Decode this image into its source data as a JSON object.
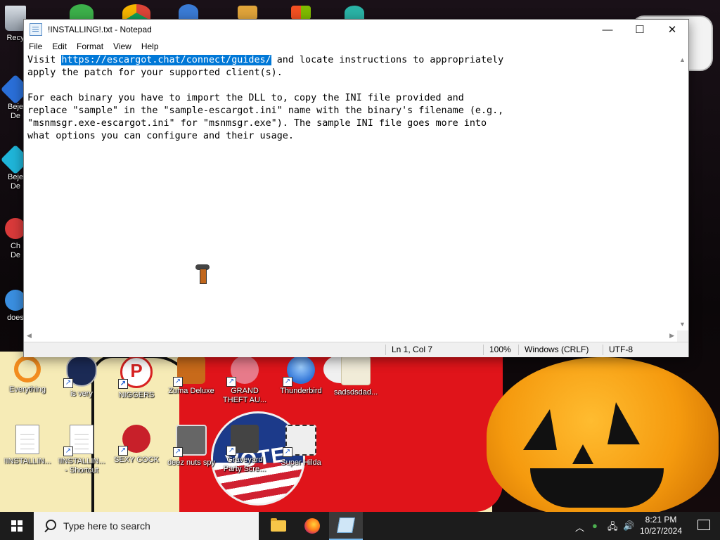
{
  "notepad": {
    "title": "!INSTALLING!.txt - Notepad",
    "controls": {
      "minimize": "—",
      "maximize": "☐",
      "close": "✕"
    },
    "menu": [
      "File",
      "Edit",
      "Format",
      "View",
      "Help"
    ],
    "text": {
      "line1_pre": "Visit ",
      "line1_selected": "https://escargot.chat/connect/guides/",
      "line1_post": " and locate instructions to appropriately",
      "line2": "apply the patch for your supported client(s).",
      "line3": "",
      "line4": "For each binary you have to import the DLL to, copy the INI file provided and",
      "line5": "replace \"sample\" in the \"sample-escargot.ini\" name with the binary's filename (e.g.,",
      "line6": "\"msnmsgr.exe-escargot.ini\" for \"msnmsgr.exe\"). The sample INI file goes more into",
      "line7": "what options you can configure and their usage."
    },
    "status": {
      "position": "Ln 1, Col 7",
      "zoom": "100%",
      "line_endings": "Windows (CRLF)",
      "encoding": "UTF-8"
    }
  },
  "desktop": {
    "left_icons": [
      {
        "label": "Recy",
        "icon": "recycle-bin-icon"
      },
      {
        "label": "Beje",
        "label2": "De",
        "icon": "bejeweled-icon"
      },
      {
        "label": "Beje",
        "label2": "De",
        "icon": "bejeweled-icon"
      },
      {
        "label": "Ch",
        "label2": "De",
        "icon": "chuzzle-icon"
      },
      {
        "label": "does",
        "icon": "app-icon"
      }
    ],
    "row1": [
      {
        "label": "Everything",
        "icon": "everything-search-icon",
        "color": "#f28c1e"
      },
      {
        "label": "is very",
        "icon": "shield-logo-icon",
        "color": "#1b2a55"
      },
      {
        "label": "NIGGERS",
        "icon": "red-p-icon",
        "color": "#d82222"
      },
      {
        "label": "Zuma Deluxe",
        "icon": "zuma-icon",
        "color": "#c86a1a"
      },
      {
        "label": "GRAND THEFT AU...",
        "icon": "anime-girl-icon",
        "color": "#e77a8a"
      },
      {
        "label": "Thunderbird",
        "icon": "thunderbird-icon",
        "color": "#2f73d6"
      },
      {
        "label": "sadsdsdad...",
        "icon": "folder-icon",
        "color": "#f1ecd8"
      }
    ],
    "row2": [
      {
        "label": "!INSTALLIN...",
        "icon": "text-file-icon"
      },
      {
        "label": "!INSTALLIN...",
        "label2": "- Shortcut",
        "icon": "text-file-icon"
      },
      {
        "label": "SEXY COCK",
        "icon": "angry-birds-icon",
        "color": "#c8202a"
      },
      {
        "label": "deez nuts spy",
        "icon": "windows-copy-icon",
        "color": "#666"
      },
      {
        "label": "Graveyard",
        "label2": "Party Scre...",
        "icon": "soldier-icon",
        "color": "#444"
      },
      {
        "label": "Super Hilda",
        "icon": "pixel-character-icon",
        "color": "#eee"
      }
    ],
    "badge_text": "VOTE"
  },
  "taskbar": {
    "search_placeholder": "Type here to search",
    "apps": [
      "file-explorer-icon",
      "firefox-icon",
      "notepad-icon"
    ],
    "clock_time": "8:21 PM",
    "clock_date": "10/27/2024"
  },
  "colors": {
    "selection": "#0078d7",
    "taskbar": "#1c1c1c",
    "accent": "#76b9ed"
  }
}
